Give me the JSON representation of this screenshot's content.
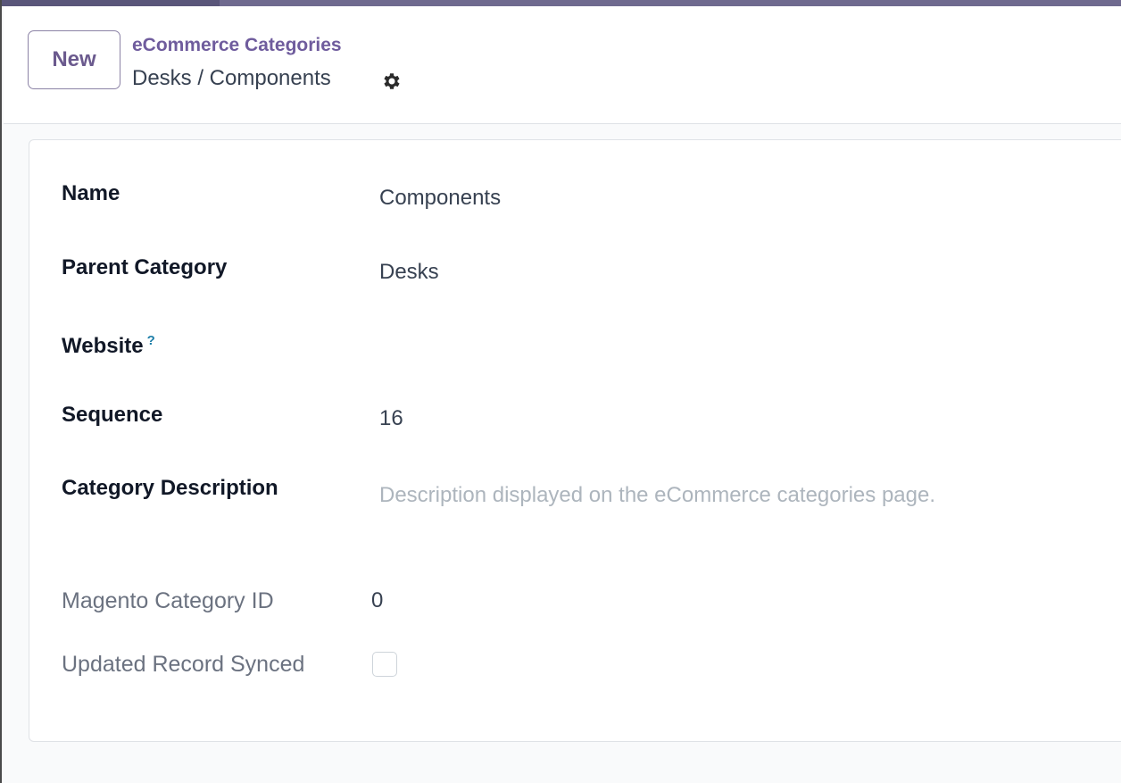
{
  "control_panel": {
    "new_button_label": "New",
    "breadcrumb_parent": "eCommerce Categories",
    "breadcrumb_current": "Desks / Components",
    "gear_icon": "gear-icon"
  },
  "form": {
    "fields": {
      "name": {
        "label": "Name",
        "value": "Components"
      },
      "parent_category": {
        "label": "Parent Category",
        "value": "Desks"
      },
      "website": {
        "label": "Website",
        "help_mark": "?",
        "value": ""
      },
      "sequence": {
        "label": "Sequence",
        "value": "16"
      },
      "category_description": {
        "label": "Category Description",
        "placeholder": "Description displayed on the eCommerce categories page."
      },
      "magento_category_id": {
        "label": "Magento Category ID",
        "value": "0"
      },
      "updated_record_synced": {
        "label": "Updated Record Synced",
        "checked": false
      }
    }
  },
  "colors": {
    "accent": "#6f5c9d",
    "help": "#1d7ea8",
    "placeholder": "#adb5bd"
  }
}
